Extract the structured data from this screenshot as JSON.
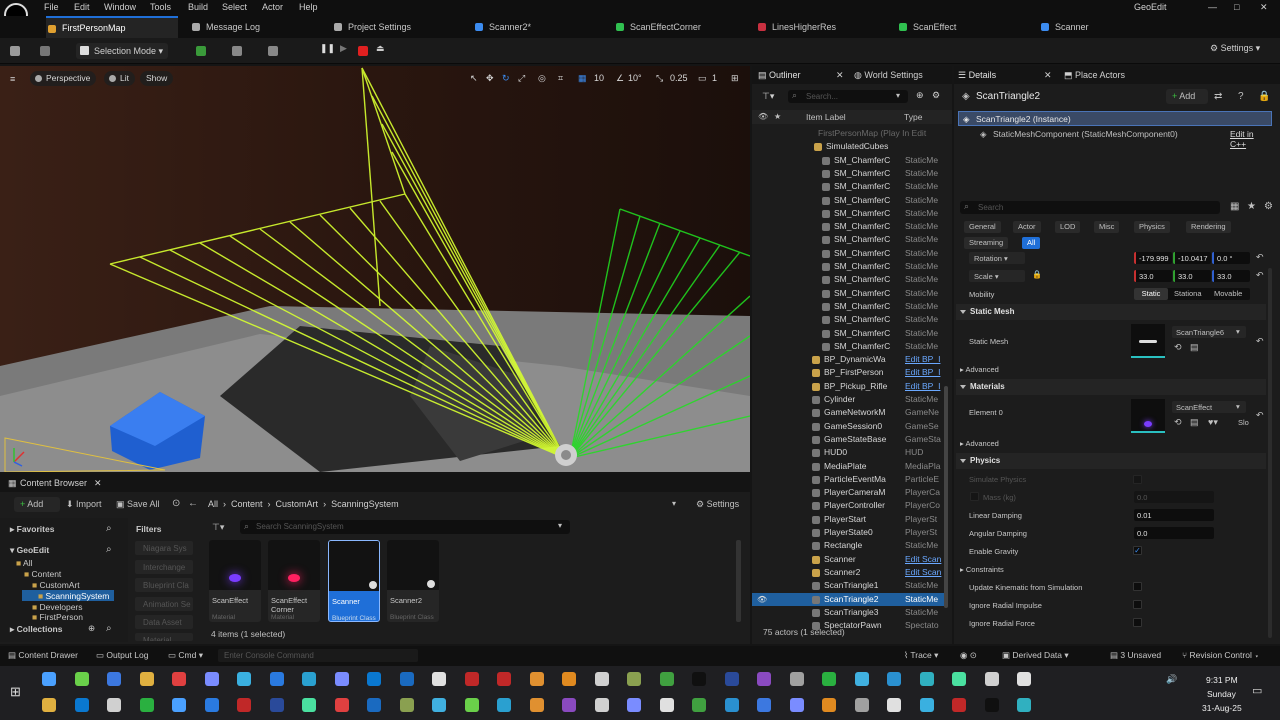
{
  "app": {
    "title": "GeoEdit"
  },
  "menu": [
    "File",
    "Edit",
    "Window",
    "Tools",
    "Build",
    "Select",
    "Actor",
    "Help"
  ],
  "tabs": [
    {
      "label": "FirstPersonMap",
      "color": "#e0a030"
    },
    {
      "label": "Message Log",
      "color": "#aaaaaa"
    },
    {
      "label": "Project Settings",
      "color": "#aaaaaa"
    },
    {
      "label": "Scanner2*",
      "color": "#3c8cf0"
    },
    {
      "label": "ScanEffectCorner",
      "color": "#30c050"
    },
    {
      "label": "LinesHigherRes",
      "color": "#c83040"
    },
    {
      "label": "ScanEffect",
      "color": "#30c050"
    },
    {
      "label": "Scanner",
      "color": "#3c8cf0"
    }
  ],
  "toolbar": {
    "mode": "Selection Mode",
    "settings": "Settings"
  },
  "viewport": {
    "perspective": "Perspective",
    "lit": "Lit",
    "show": "Show",
    "grid": "10",
    "angle": "10°",
    "scale": "0.25",
    "cam": "1"
  },
  "content_browser": {
    "title": "Content Browser",
    "add": "Add",
    "import": "Import",
    "save_all": "Save All",
    "breadcrumb": [
      "All",
      "Content",
      "CustomArt",
      "ScanningSystem"
    ],
    "settings": "Settings",
    "favorites": "Favorites",
    "project": "GeoEdit",
    "tree": [
      "All",
      "Content",
      "CustomArt",
      "ScanningSystem",
      "Developers",
      "FirstPerson"
    ],
    "collections": "Collections",
    "filters_label": "Filters",
    "filters": [
      "Niagara Sys",
      "Interchange",
      "Blueprint Cla",
      "Animation Se",
      "Data Asset",
      "Material"
    ],
    "search_placeholder": "Search ScanningSystem",
    "assets": [
      {
        "name": "ScanEffect",
        "type": "Material",
        "glow": "#7a3cff"
      },
      {
        "name": "ScanEffect Corner",
        "type": "Material",
        "glow": "#ff2060"
      },
      {
        "name": "Scanner",
        "type": "Blueprint Class",
        "glow": ""
      },
      {
        "name": "Scanner2",
        "type": "Blueprint Class",
        "glow": ""
      }
    ],
    "count": "4 items (1 selected)"
  },
  "outliner": {
    "title": "Outliner",
    "world_settings": "World Settings",
    "search_placeholder": "Search...",
    "col_label": "Item Label",
    "col_type": "Type",
    "rows": [
      {
        "name": "FirstPersonMap (Play In Edit",
        "type": "",
        "dim": true
      },
      {
        "name": "SimulatedCubes",
        "type": "",
        "folder": true
      },
      {
        "name": "SM_ChamferC",
        "type": "StaticMe"
      },
      {
        "name": "SM_ChamferC",
        "type": "StaticMe"
      },
      {
        "name": "SM_ChamferC",
        "type": "StaticMe"
      },
      {
        "name": "SM_ChamferC",
        "type": "StaticMe"
      },
      {
        "name": "SM_ChamferC",
        "type": "StaticMe"
      },
      {
        "name": "SM_ChamferC",
        "type": "StaticMe"
      },
      {
        "name": "SM_ChamferC",
        "type": "StaticMe"
      },
      {
        "name": "SM_ChamferC",
        "type": "StaticMe"
      },
      {
        "name": "SM_ChamferC",
        "type": "StaticMe"
      },
      {
        "name": "SM_ChamferC",
        "type": "StaticMe"
      },
      {
        "name": "SM_ChamferC",
        "type": "StaticMe"
      },
      {
        "name": "SM_ChamferC",
        "type": "StaticMe"
      },
      {
        "name": "SM_ChamferC",
        "type": "StaticMe"
      },
      {
        "name": "SM_ChamferC",
        "type": "StaticMe"
      },
      {
        "name": "SM_ChamferC",
        "type": "StaticMe"
      },
      {
        "name": "BP_DynamicWa",
        "type": "Edit BP_I",
        "link": true
      },
      {
        "name": "BP_FirstPerson",
        "type": "Edit BP_I",
        "link": true
      },
      {
        "name": "BP_Pickup_Rifle",
        "type": "Edit BP_I",
        "link": true
      },
      {
        "name": "Cylinder",
        "type": "StaticMe"
      },
      {
        "name": "GameNetworkM",
        "type": "GameNe"
      },
      {
        "name": "GameSession0",
        "type": "GameSe"
      },
      {
        "name": "GameStateBase",
        "type": "GameSta"
      },
      {
        "name": "HUD0",
        "type": "HUD"
      },
      {
        "name": "MediaPlate",
        "type": "MediaPla"
      },
      {
        "name": "ParticleEventMa",
        "type": "ParticleE"
      },
      {
        "name": "PlayerCameraM",
        "type": "PlayerCa"
      },
      {
        "name": "PlayerController",
        "type": "PlayerCo"
      },
      {
        "name": "PlayerStart",
        "type": "PlayerSt"
      },
      {
        "name": "PlayerState0",
        "type": "PlayerSt"
      },
      {
        "name": "Rectangle",
        "type": "StaticMe"
      },
      {
        "name": "Scanner",
        "type": "Edit Scan",
        "link": true
      },
      {
        "name": "Scanner2",
        "type": "Edit Scan",
        "link": true
      },
      {
        "name": "ScanTriangle1",
        "type": "StaticMe"
      },
      {
        "name": "ScanTriangle2",
        "type": "StaticMe",
        "selected": true
      },
      {
        "name": "ScanTriangle3",
        "type": "StaticMe"
      },
      {
        "name": "SpectatorPawn",
        "type": "Spectato"
      }
    ],
    "count": "75 actors (1 selected)"
  },
  "details": {
    "title": "Details",
    "place_actors": "Place Actors",
    "object": "ScanTriangle2",
    "add": "Add",
    "instance": "ScanTriangle2 (Instance)",
    "component": "StaticMeshComponent (StaticMeshComponent0)",
    "edit_cpp": "Edit in C++",
    "search_placeholder": "Search",
    "cats": [
      "General",
      "Actor",
      "LOD",
      "Misc",
      "Physics",
      "Rendering",
      "Streaming",
      "All"
    ],
    "rotation_label": "Rotation",
    "rotation": [
      "-179.999",
      "-10.0417",
      "0.0 °"
    ],
    "scale_label": "Scale",
    "scale": [
      "33.0",
      "33.0",
      "33.0"
    ],
    "mobility_label": "Mobility",
    "mobility": [
      "Static",
      "Stationa",
      "Movable"
    ],
    "sec_static_mesh": "Static Mesh",
    "static_mesh_label": "Static Mesh",
    "static_mesh_value": "ScanTriangle6",
    "advanced": "Advanced",
    "sec_materials": "Materials",
    "element0": "Element 0",
    "material_value": "ScanEffect",
    "slot": "Slo",
    "sec_physics": "Physics",
    "simulate": "Simulate Physics",
    "mass": "Mass (kg)",
    "mass_value": "0.0",
    "linear_damping": "Linear Damping",
    "linear_damping_value": "0.01",
    "angular_damping": "Angular Damping",
    "angular_damping_value": "0.0",
    "enable_gravity": "Enable Gravity",
    "constraints": "Constraints",
    "update_kinematic": "Update Kinematic from Simulation",
    "ignore_radial_impulse": "Ignore Radial Impulse",
    "ignore_radial_force": "Ignore Radial Force"
  },
  "status": {
    "content_drawer": "Content Drawer",
    "output_log": "Output Log",
    "cmd": "Cmd",
    "console_placeholder": "Enter Console Command",
    "trace": "Trace",
    "derived": "Derived Data",
    "unsaved": "3 Unsaved",
    "revision": "Revision Control"
  },
  "taskbar": {
    "time": "9:31 PM",
    "day": "Sunday",
    "date": "31-Aug-25"
  }
}
